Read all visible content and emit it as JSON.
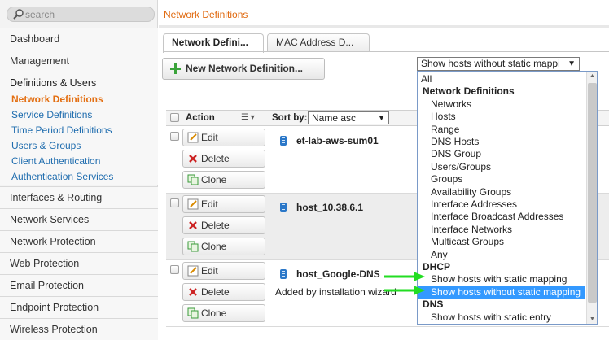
{
  "search": {
    "placeholder": "search"
  },
  "sidebar": {
    "items": [
      {
        "label": "Dashboard"
      },
      {
        "label": "Management"
      },
      {
        "label": "Definitions & Users"
      },
      {
        "label": "Interfaces & Routing"
      },
      {
        "label": "Network Services"
      },
      {
        "label": "Network Protection"
      },
      {
        "label": "Web Protection"
      },
      {
        "label": "Email Protection"
      },
      {
        "label": "Endpoint Protection"
      },
      {
        "label": "Wireless Protection"
      }
    ],
    "subitems": [
      {
        "label": "Network Definitions"
      },
      {
        "label": "Service Definitions"
      },
      {
        "label": "Time Period Definitions"
      },
      {
        "label": "Users & Groups"
      },
      {
        "label": "Client Authentication"
      },
      {
        "label": "Authentication Services"
      }
    ]
  },
  "header": {
    "title": "Network Definitions"
  },
  "tabs": [
    {
      "label": "Network Defini..."
    },
    {
      "label": "MAC Address D..."
    }
  ],
  "toolbar": {
    "new_label": "New Network Definition...",
    "filter_value": "Show hosts without static mappi"
  },
  "list": {
    "action_label": "Action",
    "sortby_label": "Sort by:",
    "sort_value": "Name asc",
    "buttons": {
      "edit": "Edit",
      "delete": "Delete",
      "clone": "Clone"
    },
    "rows": [
      {
        "name": "et-lab-aws-sum01",
        "comment": ""
      },
      {
        "name": "host_10.38.6.1",
        "comment": ""
      },
      {
        "name": "host_Google-DNS",
        "comment": "Added by installation wizard"
      }
    ]
  },
  "dropdown": {
    "options": [
      {
        "label": "All",
        "kind": "top"
      },
      {
        "label": "Network Definitions",
        "kind": "grp"
      },
      {
        "label": "Networks",
        "kind": "itm"
      },
      {
        "label": "Hosts",
        "kind": "itm"
      },
      {
        "label": "Range",
        "kind": "itm"
      },
      {
        "label": "DNS Hosts",
        "kind": "itm"
      },
      {
        "label": "DNS Group",
        "kind": "itm"
      },
      {
        "label": "Users/Groups",
        "kind": "itm"
      },
      {
        "label": "Groups",
        "kind": "itm"
      },
      {
        "label": "Availability Groups",
        "kind": "itm"
      },
      {
        "label": "Interface Addresses",
        "kind": "itm"
      },
      {
        "label": "Interface Broadcast Addresses",
        "kind": "itm"
      },
      {
        "label": "Interface Networks",
        "kind": "itm"
      },
      {
        "label": "Multicast Groups",
        "kind": "itm"
      },
      {
        "label": "Any",
        "kind": "itm"
      },
      {
        "label": "DHCP",
        "kind": "grp"
      },
      {
        "label": "Show hosts with static mapping",
        "kind": "itm"
      },
      {
        "label": "Show hosts without static mapping",
        "kind": "itm",
        "selected": true
      },
      {
        "label": "DNS",
        "kind": "grp"
      },
      {
        "label": "Show hosts with static entry",
        "kind": "itm"
      }
    ]
  },
  "colors": {
    "accent": "#e06a10",
    "link": "#1e6cae",
    "selected": "#3399ff",
    "annotation": "#22dd22"
  }
}
